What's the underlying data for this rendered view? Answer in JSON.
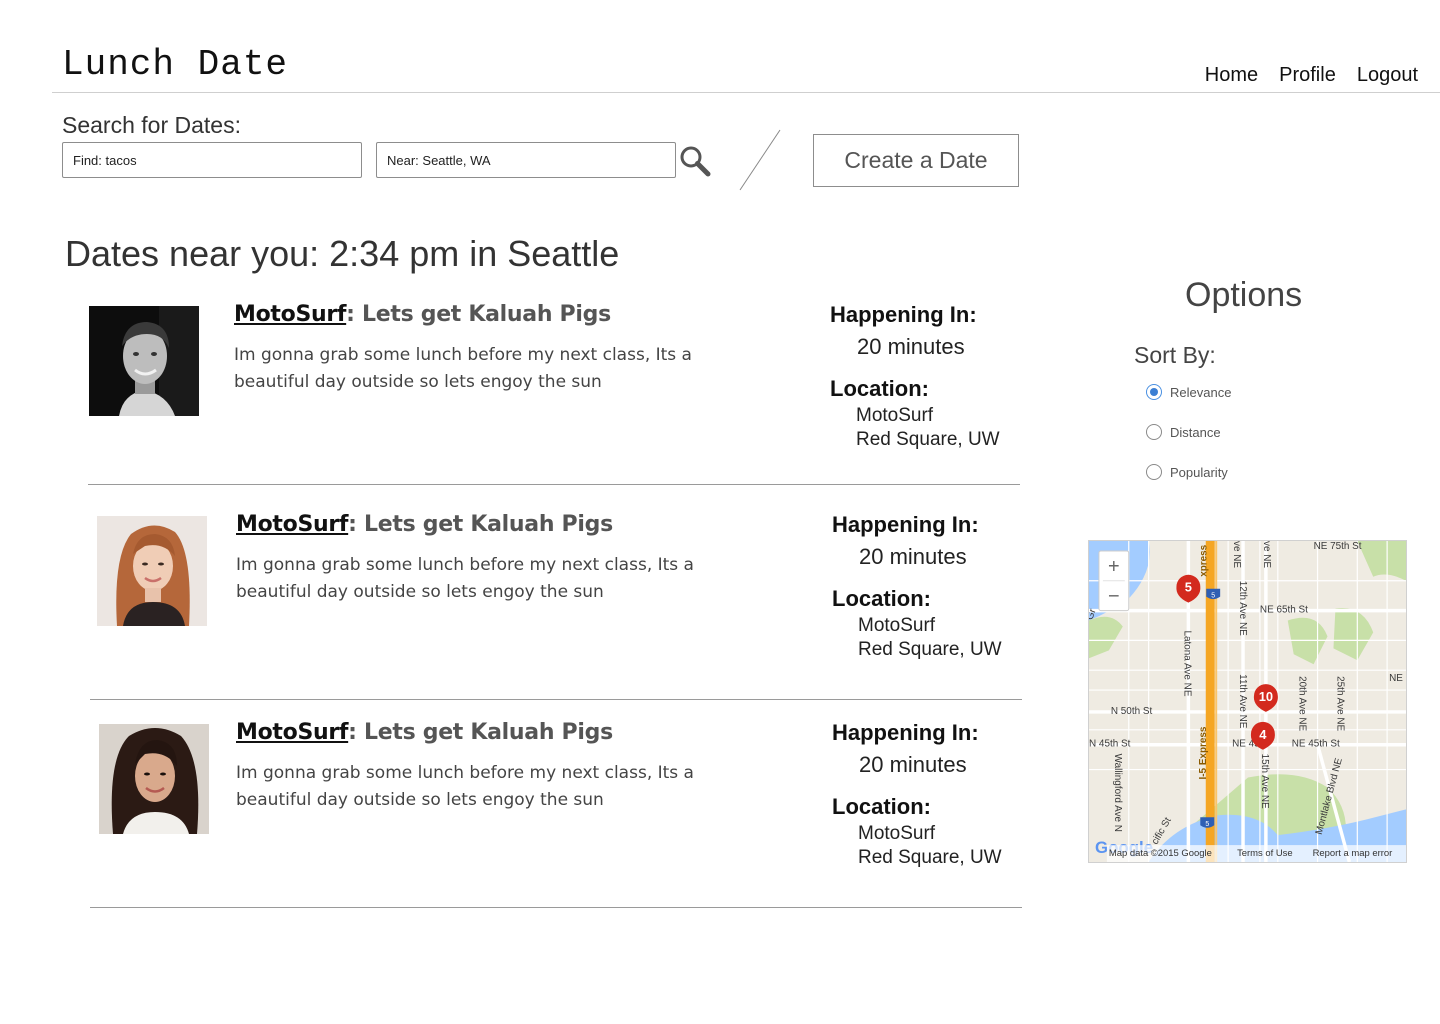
{
  "header": {
    "logo": "Lunch Date",
    "nav": [
      {
        "label": "Home"
      },
      {
        "label": "Profile"
      },
      {
        "label": "Logout"
      }
    ]
  },
  "search": {
    "label": "Search for Dates:",
    "find_value": "Find: tacos",
    "near_value": "Near: Seattle, WA",
    "search_icon": "magnifier-icon",
    "create_label": "Create a Date"
  },
  "main": {
    "heading": "Dates near you: 2:34 pm in Seattle",
    "dates": [
      {
        "user": "MotoSurf",
        "separator": ":",
        "title": " Lets get Kaluah Pigs",
        "description": "Im gonna grab some lunch before my next class, Its a beautiful day outside so lets engoy the sun",
        "happening_label": "Happening In:",
        "happening_value": "20 minutes",
        "location_label": "Location:",
        "location_name": "MotoSurf",
        "location_place": "Red Square, UW",
        "avatar": "man-portrait-photo"
      },
      {
        "user": "MotoSurf",
        "separator": ":",
        "title": " Lets get Kaluah Pigs",
        "description": "Im gonna grab some lunch before my next class, Its a beautiful day outside so lets engoy the sun",
        "happening_label": "Happening In:",
        "happening_value": "20 minutes",
        "location_label": "Location:",
        "location_name": "MotoSurf",
        "location_place": "Red Square, UW",
        "avatar": "woman-auburn-hair-photo"
      },
      {
        "user": "MotoSurf",
        "separator": ":",
        "title": " Lets get Kaluah Pigs",
        "description": "Im gonna grab some lunch before my next class, Its a beautiful day outside so lets engoy the sun",
        "happening_label": "Happening In:",
        "happening_value": "20 minutes",
        "location_label": "Location:",
        "location_name": "MotoSurf",
        "location_place": "Red Square, UW",
        "avatar": "woman-dark-hair-photo"
      }
    ]
  },
  "options": {
    "title": "Options",
    "sort_label": "Sort By:",
    "sort_options": [
      {
        "label": "Relevance",
        "selected": true
      },
      {
        "label": "Distance",
        "selected": false
      },
      {
        "label": "Popularity",
        "selected": false
      }
    ]
  },
  "map": {
    "zoom_in": "+",
    "zoom_out": "−",
    "streets": {
      "ne75": "NE 75th St",
      "ne65": "NE 65th St",
      "n50": "N 50th St",
      "n45": "N 45th St",
      "ne45_mid": "NE 45th",
      "ne45_right": "NE 45th St",
      "ne_edge": "NE 5",
      "express": "I-5 Express",
      "express_top": "xpress",
      "latona": "Latona Ave NE",
      "twelfth": "12th Ave NE",
      "eleventh": "11th Ave NE",
      "fifteenth": "15th Ave NE",
      "twentieth": "20th Ave NE",
      "twentyfifth": "25th Ave NE",
      "montlake": "Montlake Blvd NE",
      "wallingford": "Wallingford Ave N",
      "pacific": "cific St",
      "ve_ne": "ve NE",
      "gr": "Gr",
      "i5_shield": "5"
    },
    "markers": [
      "5",
      "10",
      "4"
    ],
    "google": "Google",
    "attribution": "Map data ©2015 Google",
    "terms": "Terms of Use",
    "report": "Report a map error",
    "colors": {
      "highway": "#f5a623",
      "marker": "#d32a1e",
      "water": "#a3ccff",
      "park": "#c8e0a8",
      "land": "#efebe2"
    }
  }
}
